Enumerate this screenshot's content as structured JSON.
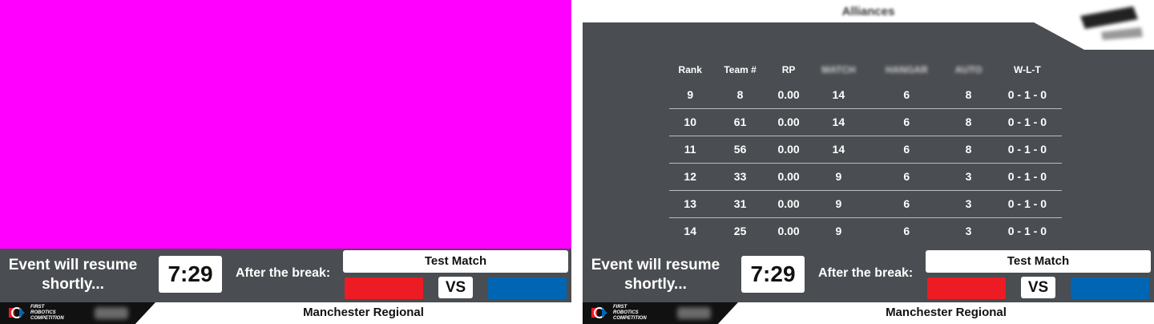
{
  "left_panel": {
    "background_color": "#ff00ff"
  },
  "right_panel": {
    "title": "Alliances",
    "game_logo_icon": "charged-up-logo",
    "standings": {
      "headers": [
        "Rank",
        "Team #",
        "RP",
        "MATCH",
        "HANGAR",
        "AUTO",
        "W-L-T"
      ],
      "rows": [
        [
          "9",
          "8",
          "0.00",
          "14",
          "6",
          "8",
          "0 - 1 - 0"
        ],
        [
          "10",
          "61",
          "0.00",
          "14",
          "6",
          "8",
          "0 - 1 - 0"
        ],
        [
          "11",
          "56",
          "0.00",
          "14",
          "6",
          "8",
          "0 - 1 - 0"
        ],
        [
          "12",
          "33",
          "0.00",
          "9",
          "6",
          "3",
          "0 - 1 - 0"
        ],
        [
          "13",
          "31",
          "0.00",
          "9",
          "6",
          "3",
          "0 - 1 - 0"
        ],
        [
          "14",
          "25",
          "0.00",
          "9",
          "6",
          "3",
          "0 - 1 - 0"
        ]
      ]
    }
  },
  "bottom_bar": {
    "resume_text": "Event will resume shortly...",
    "timer": "7:29",
    "after_label": "After the break:",
    "match_name": "Test Match",
    "vs": "VS",
    "red_color": "#ed1c24",
    "blue_color": "#0066b3"
  },
  "footer": {
    "logo_icon": "first-robotics-logo",
    "logo_text_line1": "FIRST",
    "logo_text_line2": "ROBOTICS",
    "logo_text_line3": "COMPETITION",
    "event_name": "Manchester Regional"
  }
}
